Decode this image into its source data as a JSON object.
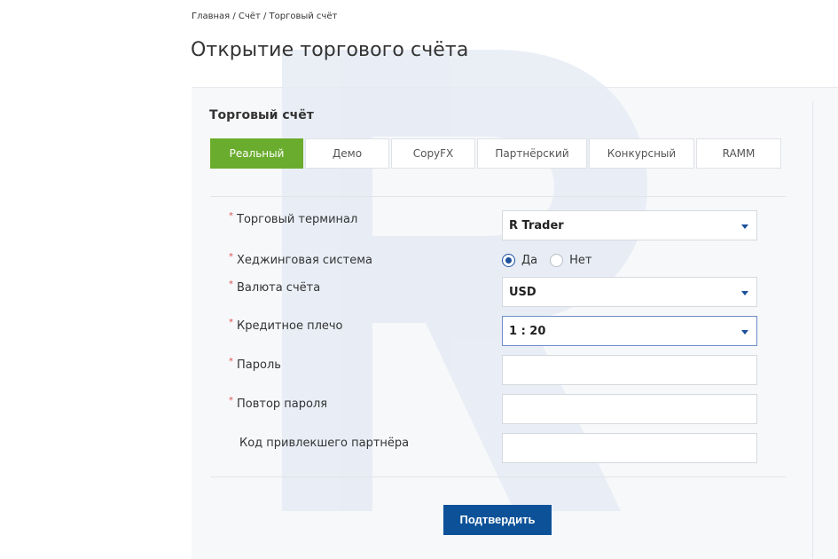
{
  "breadcrumb": "Главная / Счёт / Торговый счёт",
  "page_title": "Открытие торгового счёта",
  "section_title": "Торговый счёт",
  "tabs": [
    {
      "label": "Реальный",
      "active": true
    },
    {
      "label": "Демо",
      "active": false
    },
    {
      "label": "CopyFX",
      "active": false
    },
    {
      "label": "Партнёрский",
      "active": false
    },
    {
      "label": "Конкурсный",
      "active": false
    },
    {
      "label": "RAMM",
      "active": false
    }
  ],
  "form": {
    "terminal": {
      "label": "Торговый терминал",
      "required": true,
      "value": "R Trader"
    },
    "hedging": {
      "label": "Хеджинговая система",
      "required": true,
      "options": [
        "Да",
        "Нет"
      ],
      "selected": "Да"
    },
    "currency": {
      "label": "Валюта счёта",
      "required": true,
      "value": "USD"
    },
    "leverage": {
      "label": "Кредитное плечо",
      "required": true,
      "value": "1 : 20"
    },
    "password": {
      "label": "Пароль",
      "required": true,
      "value": ""
    },
    "password_repeat": {
      "label": "Повтор пароля",
      "required": true,
      "value": ""
    },
    "partner_code": {
      "label": "Код привлекшего партнёра",
      "required": false,
      "value": ""
    },
    "required_mark": "*"
  },
  "submit_label": "Подтвердить",
  "colors": {
    "accent_green": "#6aad2e",
    "primary_blue": "#0d5299",
    "required_red": "#d9534f",
    "watermark_blue": "#e9eef6"
  },
  "icons": {
    "dropdown": "caret-down-icon",
    "watermark": "brand-letter-r-watermark"
  }
}
